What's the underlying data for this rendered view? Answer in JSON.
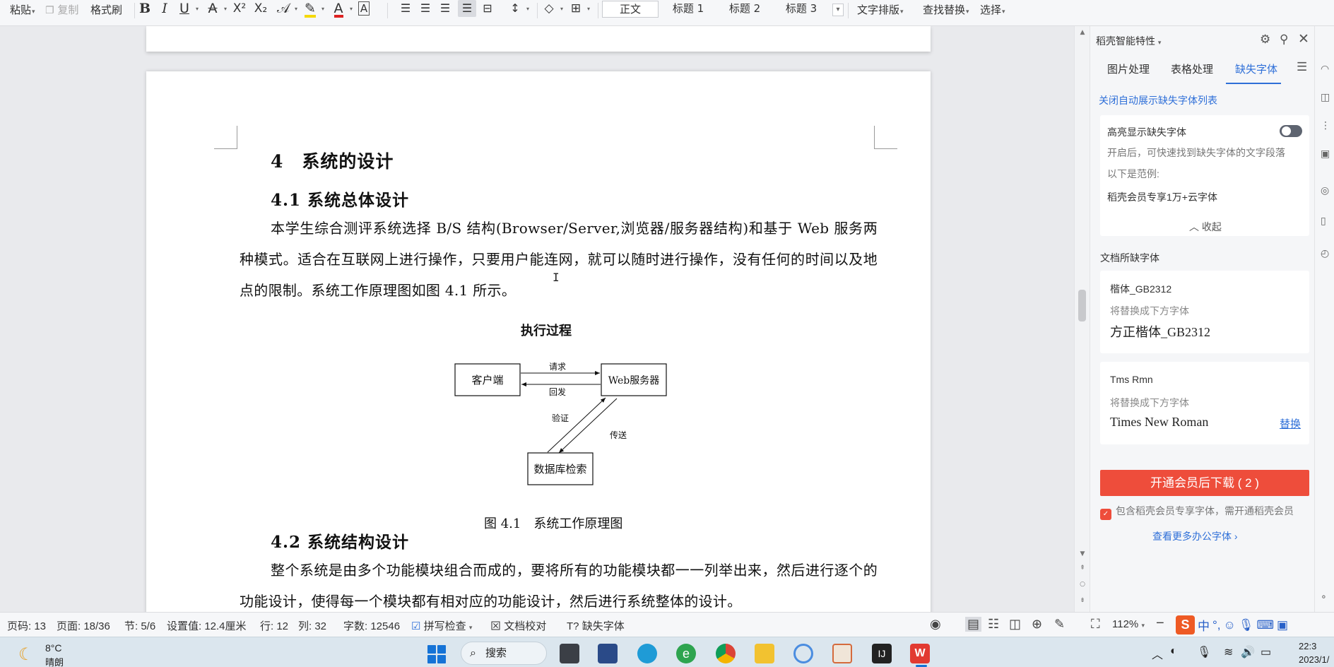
{
  "toolbar": {
    "paste": "粘贴",
    "copy": "复制",
    "format_painter": "格式刷",
    "styles": [
      "正文",
      "标题 1",
      "标题 2",
      "标题 3"
    ],
    "text_layout": "文字排版",
    "find_replace": "查找替换",
    "select": "选择",
    "superscript": "X²",
    "subscript": "X₂"
  },
  "document": {
    "heading1": "4　系统的设计",
    "heading2a": "4.1  系统总体设计",
    "para1": "本学生综合测评系统选择 B/S 结构(Browser/Server,浏览器/服务器结构)和基于 Web 服务两种模式。适合在互联网上进行操作，只要用户能连网，就可以随时进行操作，没有任何的时间以及地点的限制。系统工作原理图如图 4.1 所示。",
    "figure_title": "执行过程",
    "diagram": {
      "client": "客户端",
      "server": "Web服务器",
      "db": "数据库检索",
      "request": "请求",
      "reply": "回发",
      "verify": "验证",
      "transfer": "传送"
    },
    "figure_caption": "图 4.1　系统工作原理图",
    "heading2b": "4.2  系统结构设计",
    "para2": "整个系统是由多个功能模块组合而成的，要将所有的功能模块都一一列举出来，然后进行逐个的功能设计，使得每一个模块都有相对应的功能设计，然后进行系统整体的设计。"
  },
  "panel": {
    "title": "稻壳智能特性",
    "tabs": [
      "图片处理",
      "表格处理",
      "缺失字体"
    ],
    "active_tab": "缺失字体",
    "close_auto_link": "关闭自动展示缺失字体列表",
    "highlight_card": {
      "title": "高亮显示缺失字体",
      "toggle_on": false,
      "desc": "开启后，可快速找到缺失字体的文字段落",
      "example_label": "以下是范例:",
      "example": "稻壳会员专享1万+云字体",
      "collapse": "收起"
    },
    "section_title": "文档所缺字体",
    "missing_fonts": [
      {
        "name": "楷体_GB2312",
        "hint": "将替换成下方字体",
        "replacement": "方正楷体_GB2312",
        "action": ""
      },
      {
        "name": "Tms Rmn",
        "hint": "将替换成下方字体",
        "replacement": "Times New Roman",
        "action": "替换"
      }
    ],
    "download_button": "开通会员后下载 ( 2 )",
    "notice": "包含稻壳会员专享字体，需开通稻壳会员",
    "more_link": "查看更多办公字体"
  },
  "statusbar": {
    "page_num": "页码: 13",
    "pages": "页面: 18/36",
    "section": "节: 5/6",
    "setting": "设置值: 12.4厘米",
    "row": "行: 12",
    "col": "列: 32",
    "word_count": "字数: 12546",
    "spell_check": "拼写检查",
    "doc_proof": "文档校对",
    "missing_font": "缺失字体",
    "zoom": "112%",
    "ime_lang": "中"
  },
  "taskbar": {
    "temperature": "8°C",
    "condition": "晴朗",
    "search_label": "搜索",
    "time": "22:3",
    "date": "2023/1/"
  },
  "colors": {
    "accent_blue": "#2e6fd8",
    "download_red": "#ee4d3b",
    "page_bg": "#ffffff"
  }
}
